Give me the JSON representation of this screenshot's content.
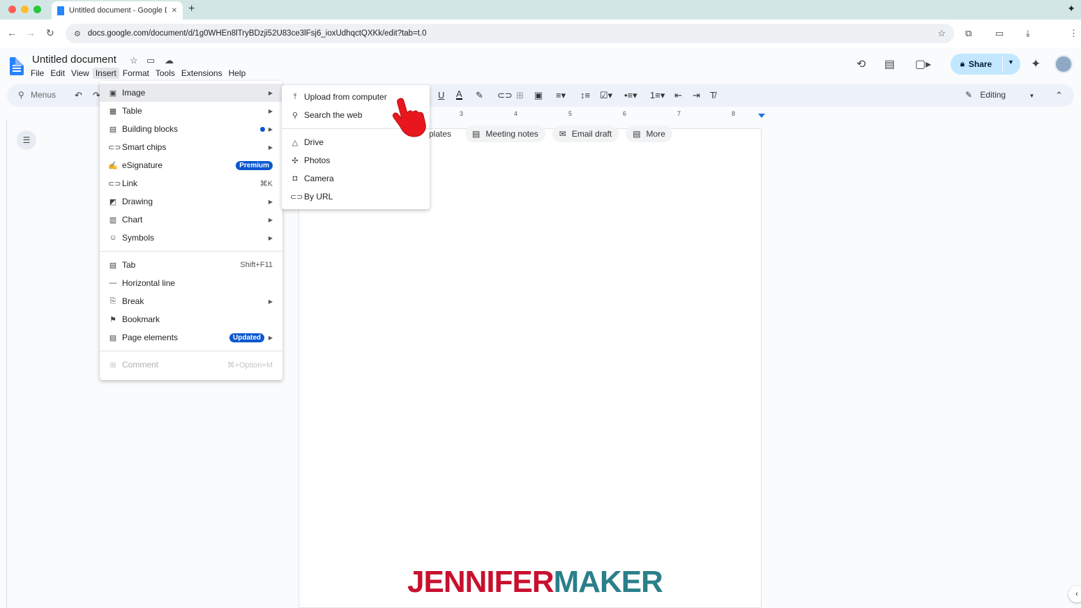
{
  "browser": {
    "tab_title": "Untitled document - Google Docs",
    "url": "docs.google.com/document/d/1g0WHEn8lTryBDzji52U83ce3lFsj6_ioxUdhqctQXKk/edit?tab=t.0",
    "new_tab": "+",
    "close_tab": "✕"
  },
  "docs": {
    "title": "Untitled document",
    "menus": [
      "File",
      "Edit",
      "View",
      "Insert",
      "Format",
      "Tools",
      "Extensions",
      "Help"
    ],
    "share_label": "Share",
    "editing_label": "Editing",
    "menus_search_label": "Menus"
  },
  "ruler": {
    "numbers": [
      "3",
      "4",
      "5",
      "6",
      "7",
      "8"
    ]
  },
  "chips": [
    {
      "label": "plates",
      "icon": "template-icon"
    },
    {
      "label": "Meeting notes",
      "icon": "document-icon"
    },
    {
      "label": "Email draft",
      "icon": "email-icon"
    },
    {
      "label": "More",
      "icon": "more-icon"
    }
  ],
  "insert_menu": {
    "items": [
      {
        "label": "Image",
        "icon": "image-icon",
        "arrow": true
      },
      {
        "label": "Table",
        "icon": "table-icon",
        "arrow": true
      },
      {
        "label": "Building blocks",
        "icon": "building-blocks-icon",
        "arrow": true,
        "dot": true
      },
      {
        "label": "Smart chips",
        "icon": "smart-chips-icon",
        "arrow": true
      },
      {
        "label": "eSignature",
        "icon": "signature-icon",
        "badge": "Premium"
      },
      {
        "label": "Link",
        "icon": "link-icon",
        "shortcut": "⌘K"
      },
      {
        "label": "Drawing",
        "icon": "drawing-icon",
        "arrow": true
      },
      {
        "label": "Chart",
        "icon": "chart-icon",
        "arrow": true
      },
      {
        "label": "Symbols",
        "icon": "emoji-icon",
        "arrow": true
      },
      {
        "label": "Tab",
        "icon": "tab-icon",
        "shortcut": "Shift+F11"
      },
      {
        "label": "Horizontal line",
        "icon": "horizontal-line-icon"
      },
      {
        "label": "Break",
        "icon": "break-icon",
        "arrow": true
      },
      {
        "label": "Bookmark",
        "icon": "bookmark-icon"
      },
      {
        "label": "Page elements",
        "icon": "page-elements-icon",
        "arrow": true,
        "badge": "Updated"
      },
      {
        "label": "Comment",
        "icon": "comment-icon",
        "shortcut": "⌘+Option+M",
        "disabled": true
      }
    ]
  },
  "image_submenu": {
    "items": [
      {
        "label": "Upload from computer",
        "icon": "upload-icon"
      },
      {
        "label": "Search the web",
        "icon": "search-icon"
      },
      {
        "label": "Drive",
        "icon": "drive-icon"
      },
      {
        "label": "Photos",
        "icon": "photos-icon"
      },
      {
        "label": "Camera",
        "icon": "camera-icon"
      },
      {
        "label": "By URL",
        "icon": "link-icon"
      }
    ]
  },
  "watermark": {
    "part1": "JENNIFER",
    "part2": "MAKER"
  },
  "colors": {
    "accent": "#0b57d0",
    "share_bg": "#c2e7ff",
    "watermark_red": "#c8102e",
    "watermark_teal": "#2a7f8a"
  }
}
